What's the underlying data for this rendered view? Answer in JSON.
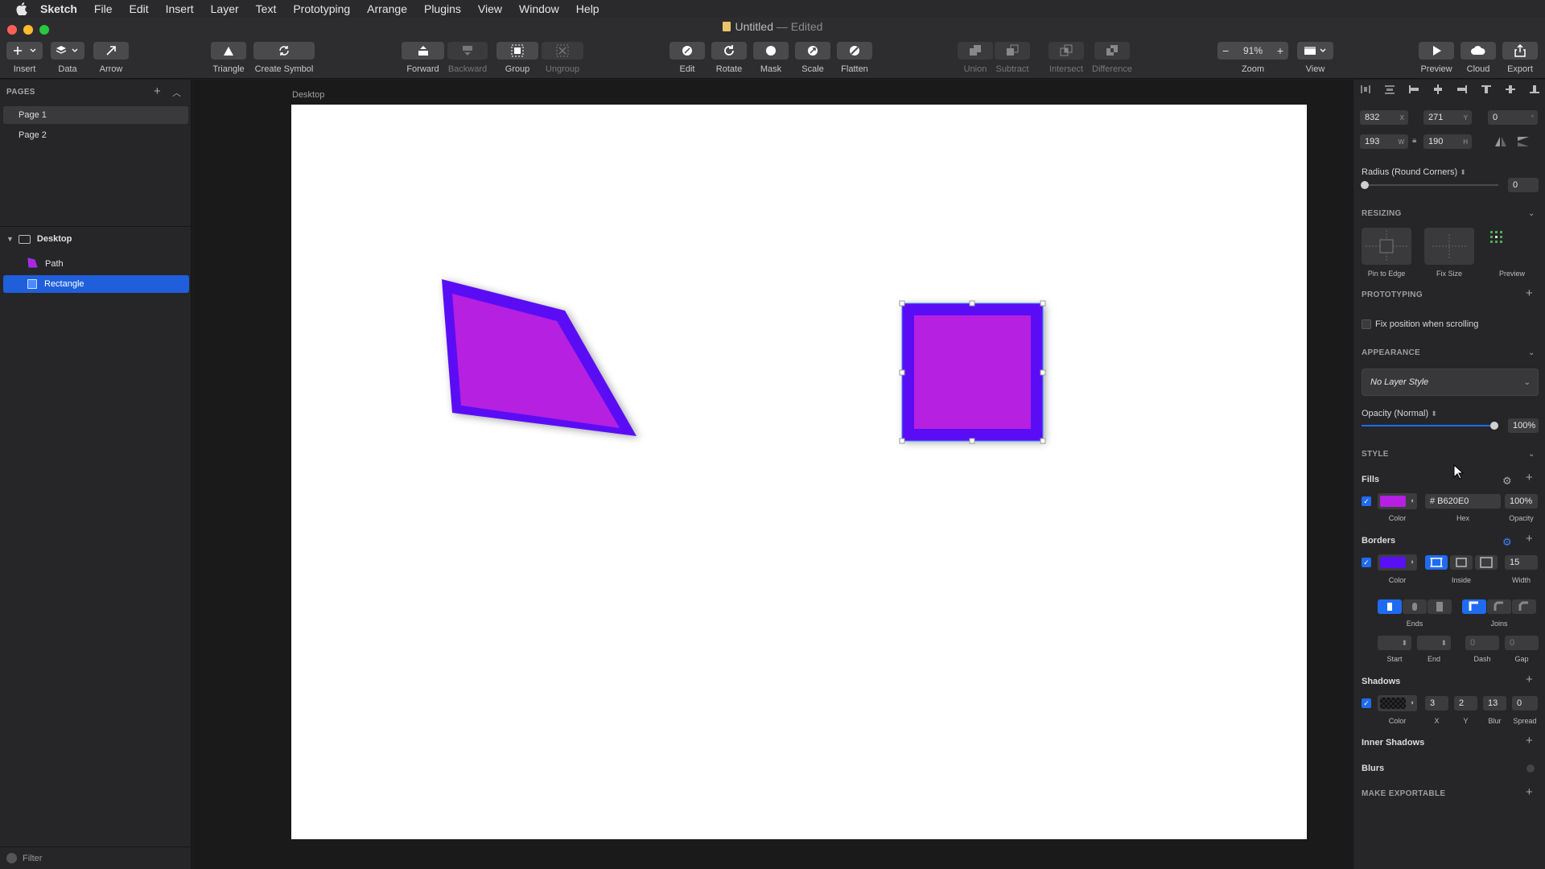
{
  "menubar": {
    "items": [
      "Sketch",
      "File",
      "Edit",
      "Insert",
      "Layer",
      "Text",
      "Prototyping",
      "Arrange",
      "Plugins",
      "View",
      "Window",
      "Help"
    ]
  },
  "window": {
    "title": "Untitled",
    "status": "— Edited"
  },
  "toolbar": {
    "insert": "Insert",
    "data": "Data",
    "arrow": "Arrow",
    "triangle": "Triangle",
    "create_symbol": "Create Symbol",
    "forward": "Forward",
    "backward": "Backward",
    "group": "Group",
    "ungroup": "Ungroup",
    "edit": "Edit",
    "rotate": "Rotate",
    "mask": "Mask",
    "scale": "Scale",
    "flatten": "Flatten",
    "union": "Union",
    "subtract": "Subtract",
    "intersect": "Intersect",
    "difference": "Difference",
    "zoom": "Zoom",
    "zoom_value": "91%",
    "view": "View",
    "preview": "Preview",
    "cloud": "Cloud",
    "export": "Export"
  },
  "left_panel": {
    "pages_header": "PAGES",
    "pages": [
      "Page 1",
      "Page 2"
    ],
    "artboard": "Desktop",
    "layers": [
      "Path",
      "Rectangle"
    ],
    "filter": "Filter"
  },
  "canvas": {
    "artboard_label": "Desktop"
  },
  "inspector": {
    "x": "832",
    "x_label": "X",
    "y": "271",
    "y_label": "Y",
    "rotation": "0",
    "rotation_label": "°",
    "w": "193",
    "w_label": "W",
    "h": "190",
    "h_label": "H",
    "radius_label": "Radius (Round Corners)",
    "radius_value": "0",
    "resizing_header": "RESIZING",
    "pin_to_edge": "Pin to Edge",
    "fix_size": "Fix Size",
    "preview": "Preview",
    "prototyping_header": "PROTOTYPING",
    "fix_position": "Fix position when scrolling",
    "appearance_header": "APPEARANCE",
    "layer_style": "No Layer Style",
    "opacity_label": "Opacity (Normal)",
    "opacity_value": "100%",
    "opacity_fraction": 1.0,
    "style_header": "STYLE",
    "fills": "Fills",
    "fill_color": "#B620E0",
    "fill_hex": "# B620E0",
    "fill_opacity": "100%",
    "color_label": "Color",
    "hex_label": "Hex",
    "opacity_small": "Opacity",
    "borders": "Borders",
    "border_color": "#5A10F5",
    "border_position": "Inside",
    "border_width": "15",
    "width_label": "Width",
    "ends_label": "Ends",
    "joins_label": "Joins",
    "start_label": "Start",
    "end_label": "End",
    "dash_label": "Dash",
    "gap_label": "Gap",
    "dash_value": "0",
    "gap_value": "0",
    "shadows": "Shadows",
    "shadow_x": "3",
    "shadow_y": "2",
    "shadow_blur": "13",
    "shadow_spread": "0",
    "x_small": "X",
    "y_small": "Y",
    "blur_small": "Blur",
    "spread_small": "Spread",
    "inner_shadows": "Inner Shadows",
    "blurs": "Blurs",
    "make_exportable": "MAKE EXPORTABLE"
  },
  "colors": {
    "fill": "#B620E0",
    "border": "#5A10F5",
    "accent": "#1F6BF0"
  }
}
